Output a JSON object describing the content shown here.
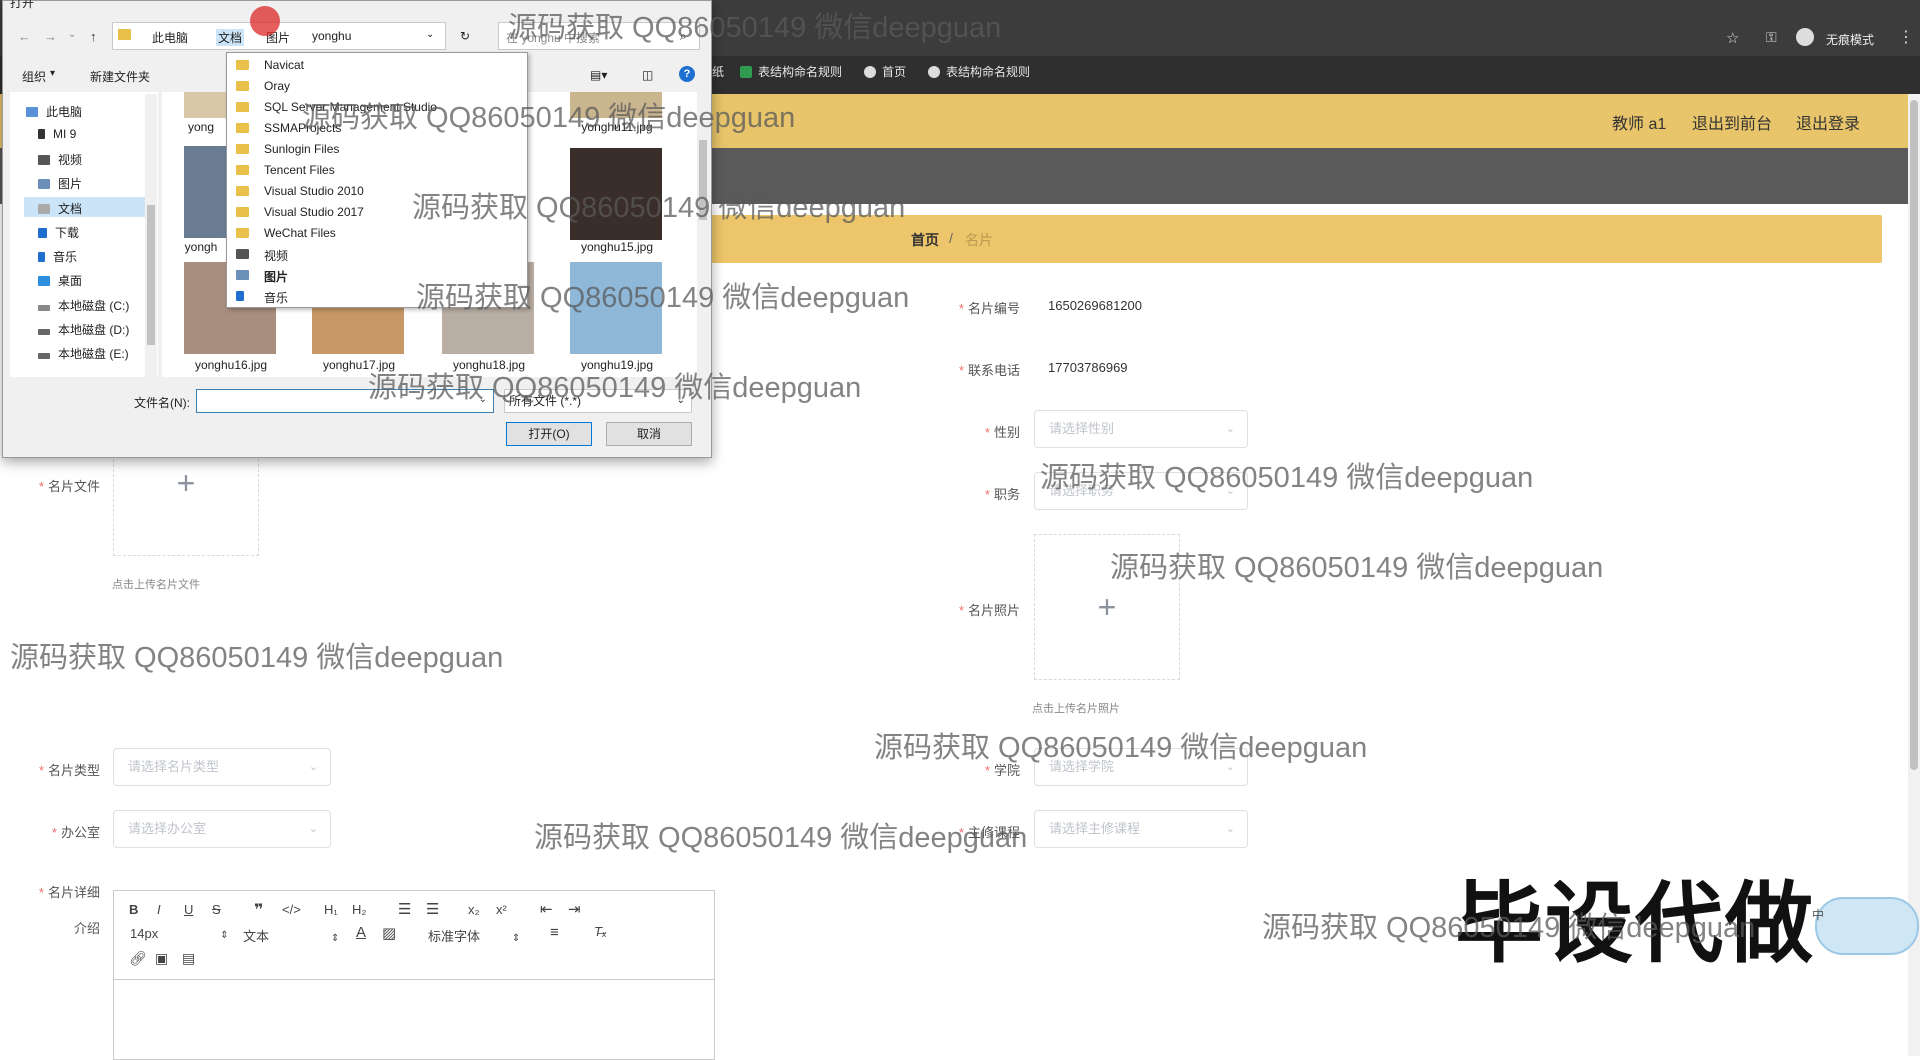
{
  "browser": {
    "incognito_label": "无痕模式",
    "bookmarks": [
      "纸",
      "表结构命名规则",
      "首页",
      "表结构命名规则"
    ]
  },
  "header": {
    "user": "教师 a1",
    "back_front": "退出到前台",
    "logout": "退出登录"
  },
  "breadcrumb": {
    "home": "首页",
    "sep": "/",
    "current": "名片"
  },
  "form": {
    "card_no_label": "名片编号",
    "card_no_value": "1650269681200",
    "phone_label": "联系电话",
    "phone_value": "17703786969",
    "gender_label": "性别",
    "gender_placeholder": "请选择性别",
    "position_label": "职务",
    "position_placeholder": "请选择职务",
    "photo_label": "名片照片",
    "photo_hint": "点击上传名片照片",
    "file_label": "名片文件",
    "file_hint": "点击上传名片文件",
    "type_label": "名片类型",
    "type_placeholder": "请选择名片类型",
    "college_label": "学院",
    "college_placeholder": "请选择学院",
    "office_label": "办公室",
    "office_placeholder": "请选择办公室",
    "course_label": "主修课程",
    "course_placeholder": "请选择主修课程",
    "detail_label_1": "名片详细",
    "detail_label_2": "介绍",
    "required_mark": "*",
    "plus": "+"
  },
  "editor": {
    "font_size": "14px",
    "text_style": "文本",
    "font_family": "标准字体"
  },
  "dialog": {
    "title": "打开",
    "address": [
      "此电脑",
      "文档",
      "图片",
      "yonghu"
    ],
    "search_placeholder": "在 yonghu 中搜索",
    "organize": "组织",
    "new_folder": "新建文件夹",
    "tree": [
      "此电脑",
      "MI 9",
      "视频",
      "图片",
      "文档",
      "下载",
      "音乐",
      "桌面",
      "本地磁盘 (C:)",
      "本地磁盘 (D:)",
      "本地磁盘 (E:)"
    ],
    "files": [
      "yonghu11.jpg",
      "yonghu15.jpg",
      "yonghu16.jpg",
      "yonghu17.jpg",
      "yonghu18.jpg",
      "yonghu19.jpg"
    ],
    "partial_labels": [
      "yong",
      "yongh"
    ],
    "filename_label": "文件名(N):",
    "filetype": "所有文件 (*.*)",
    "open_btn": "打开(O)",
    "cancel_btn": "取消",
    "dropdown": [
      "Navicat",
      "Oray",
      "SQL Server Management Studio",
      "SSMAProjects",
      "Sunlogin Files",
      "Tencent Files",
      "Visual Studio 2010",
      "Visual Studio 2017",
      "WeChat Files",
      "视频",
      "图片",
      "音乐"
    ]
  },
  "overlay": {
    "watermark": "源码获取 QQ86050149 微信deepguan",
    "big_text": "毕设代做",
    "mascot_text": "中"
  }
}
